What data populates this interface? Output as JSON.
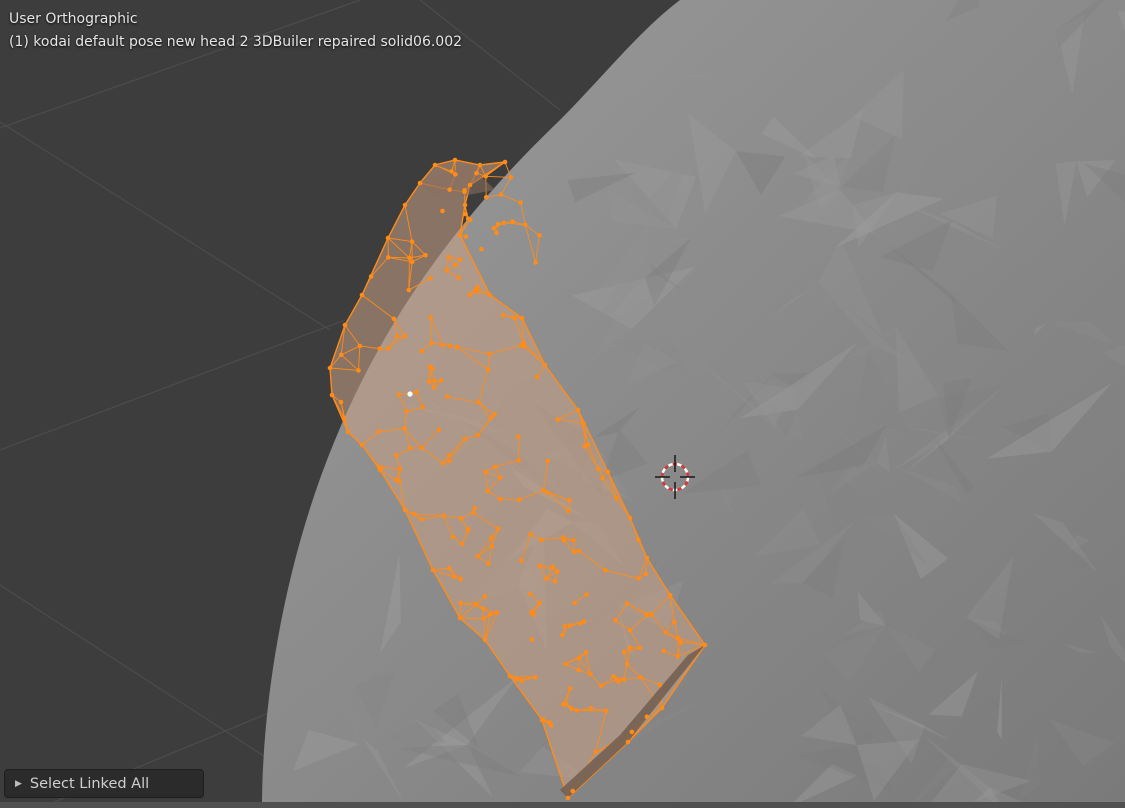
{
  "viewport": {
    "view_mode": "User Orthographic",
    "object_name": "(1) kodai default pose new head 2 3DBuiler repaired solid06.002"
  },
  "operator_panel": {
    "label": "Select Linked All",
    "arrow_icon": "triangle-right-icon"
  },
  "colors": {
    "background": "#3d3d3d",
    "mesh_surface": "#8c8c8c",
    "selection": "#ff8c19"
  },
  "icons": {
    "cursor": "3d-cursor-icon"
  }
}
